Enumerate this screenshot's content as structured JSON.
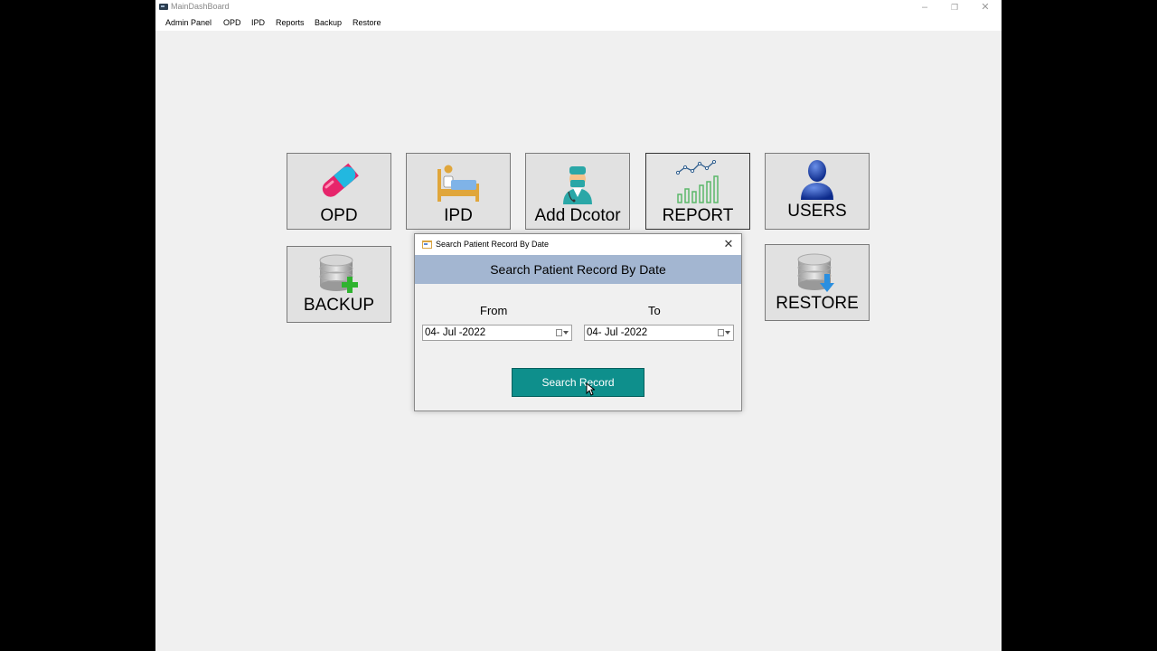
{
  "window": {
    "title": "MainDashBoard",
    "controls": {
      "minimize": "–",
      "restore": "❐",
      "close": "✕"
    }
  },
  "menubar": {
    "items": [
      "Admin Panel",
      "OPD",
      "IPD",
      "Reports",
      "Backup",
      "Restore"
    ]
  },
  "tiles": {
    "opd": "OPD",
    "ipd": "IPD",
    "add_doctor": "Add Dcotor",
    "report": "REPORT",
    "users": "USERS",
    "backup": "BACKUP",
    "restore": "RESTORE"
  },
  "dialog": {
    "title": "Search Patient Record By Date",
    "header": "Search Patient Record By Date",
    "close": "✕",
    "from_label": "From",
    "to_label": "To",
    "from_date": "04- Jul -2022",
    "to_date": "04- Jul -2022",
    "search_button": "Search Record"
  },
  "icons": [
    "pill-icon",
    "bed-icon",
    "doctor-icon",
    "chart-icon",
    "user-icon",
    "database-add-icon",
    "database-download-icon"
  ]
}
